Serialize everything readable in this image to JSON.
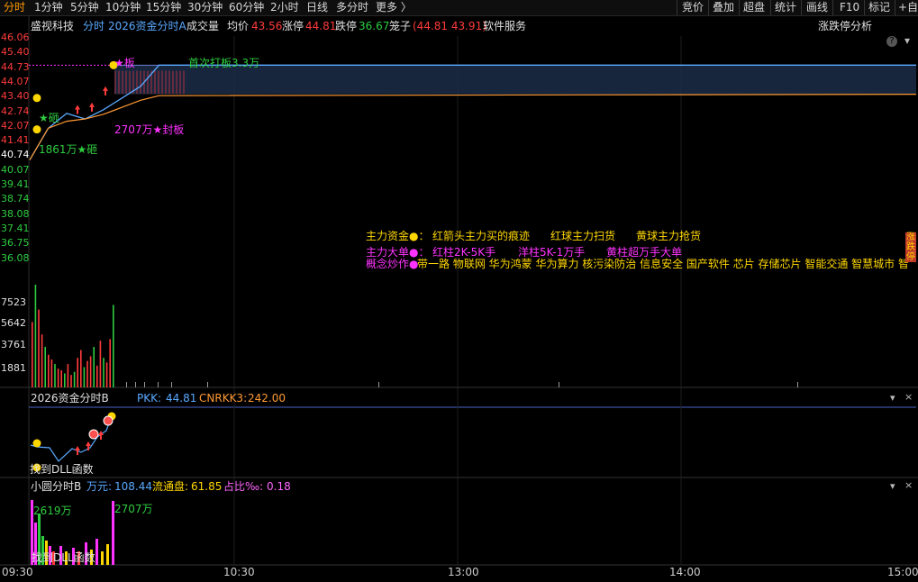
{
  "toolbar": {
    "timeframes": [
      "分时",
      "1分钟",
      "5分钟",
      "10分钟",
      "15分钟",
      "30分钟",
      "60分钟",
      "2小时",
      "日线",
      "多分时",
      "更多 〉"
    ],
    "right_tools": [
      "竞价",
      "叠加",
      "超盘",
      "统计",
      "画线",
      "F10",
      "标记",
      "+自"
    ]
  },
  "header": {
    "stock_name": "盛视科技",
    "mode": "分时",
    "indicator": "2026资金分时A",
    "volume_label": "成交量",
    "avg_label": "均价",
    "avg_value": "43.56",
    "limit_up_label": "涨停",
    "limit_up_value": "44.81",
    "limit_down_label": "跌停",
    "limit_down_value": "36.67",
    "cage_label": "笼子",
    "cage_value": "(44.81 43.91)",
    "sector": "软件服务",
    "analysis_link": "涨跌停分析"
  },
  "price_axis": {
    "ticks": [
      {
        "label": "46.06",
        "color": "#ff3b3b"
      },
      {
        "label": "45.40",
        "color": "#ff3b3b"
      },
      {
        "label": "44.73",
        "color": "#ff3b3b"
      },
      {
        "label": "44.07",
        "color": "#ff3b3b"
      },
      {
        "label": "43.40",
        "color": "#ff3b3b"
      },
      {
        "label": "42.74",
        "color": "#ff3b3b"
      },
      {
        "label": "42.07",
        "color": "#ff3b3b"
      },
      {
        "label": "41.41",
        "color": "#ff3b3b"
      },
      {
        "label": "40.74",
        "color": "#ffffff"
      },
      {
        "label": "40.07",
        "color": "#2ecc40"
      },
      {
        "label": "39.41",
        "color": "#2ecc40"
      },
      {
        "label": "38.74",
        "color": "#2ecc40"
      },
      {
        "label": "38.08",
        "color": "#2ecc40"
      },
      {
        "label": "37.41",
        "color": "#2ecc40"
      },
      {
        "label": "36.75",
        "color": "#2ecc40"
      },
      {
        "label": "36.08",
        "color": "#2ecc40"
      }
    ]
  },
  "volume_axis": {
    "ticks": [
      "7523",
      "5642",
      "3761",
      "1881"
    ]
  },
  "annotations": {
    "limit_up": "★板",
    "first_limit": "首次打板3.3万",
    "smash": "★砸",
    "smash_amount": "1861万★砸",
    "seal_amount": "2707万★封板"
  },
  "legend": {
    "line1": [
      "主力资金●：",
      "红箭头主力买的痕迹",
      "红球主力扫货",
      "黄球主力抢货"
    ],
    "line2": [
      "主力大单●：",
      "红柱2K-5K手",
      "洋柱5K-1万手",
      "黄柱超万手大单"
    ],
    "line3_label": "概念炒作●",
    "concepts": "带一路 物联网 华为鸿蒙 华为算力 核污染防治 信息安全 国产软件 芯片 存储芯片 智能交通 智慧城市 智"
  },
  "side_tag": "涨跌停",
  "panel_b": {
    "title": "2026资金分时B",
    "pkk_label": "PKK:",
    "pkk_value": "44.81",
    "cnrkk_label": "CNRKK3:",
    "cnrkk_value": "242.00",
    "note": "找到DLL函数"
  },
  "panel_c": {
    "title": "小圆分时B",
    "wan_label": "万元:",
    "wan_value": "108.44",
    "float_label": "流通盘:",
    "float_value": "61.85",
    "ratio_label": "占比‰:",
    "ratio_value": "0.18",
    "left_amount": "2619万",
    "right_amount": "2707万",
    "note": "找到DLL函数"
  },
  "time_axis": [
    "09:30",
    "10:30",
    "13:00",
    "14:00",
    "15:00"
  ],
  "chart_data": {
    "type": "line",
    "title": "",
    "x": [
      "09:30",
      "09:35",
      "09:40",
      "09:45",
      "09:50",
      "09:55",
      "10:00",
      "10:05",
      "15:00"
    ],
    "series": [
      {
        "name": "",
        "values": [
          40.74,
          42.1,
          42.74,
          42.5,
          42.9,
          43.4,
          43.9,
          44.81,
          44.81
        ]
      },
      {
        "name": "均价",
        "values": [
          40.74,
          42.1,
          42.4,
          42.5,
          42.7,
          43.0,
          43.3,
          43.5,
          43.56
        ]
      }
    ],
    "ylim": [
      36.08,
      46.06
    ],
    "volume_ylim": [
      0,
      7523
    ],
    "colors": {
      "price": "#5aa9ff",
      "avg": "#ff9933",
      "limit": "#6b7fd6",
      "up": "#ff3b3b",
      "down": "#2ecc40"
    }
  }
}
